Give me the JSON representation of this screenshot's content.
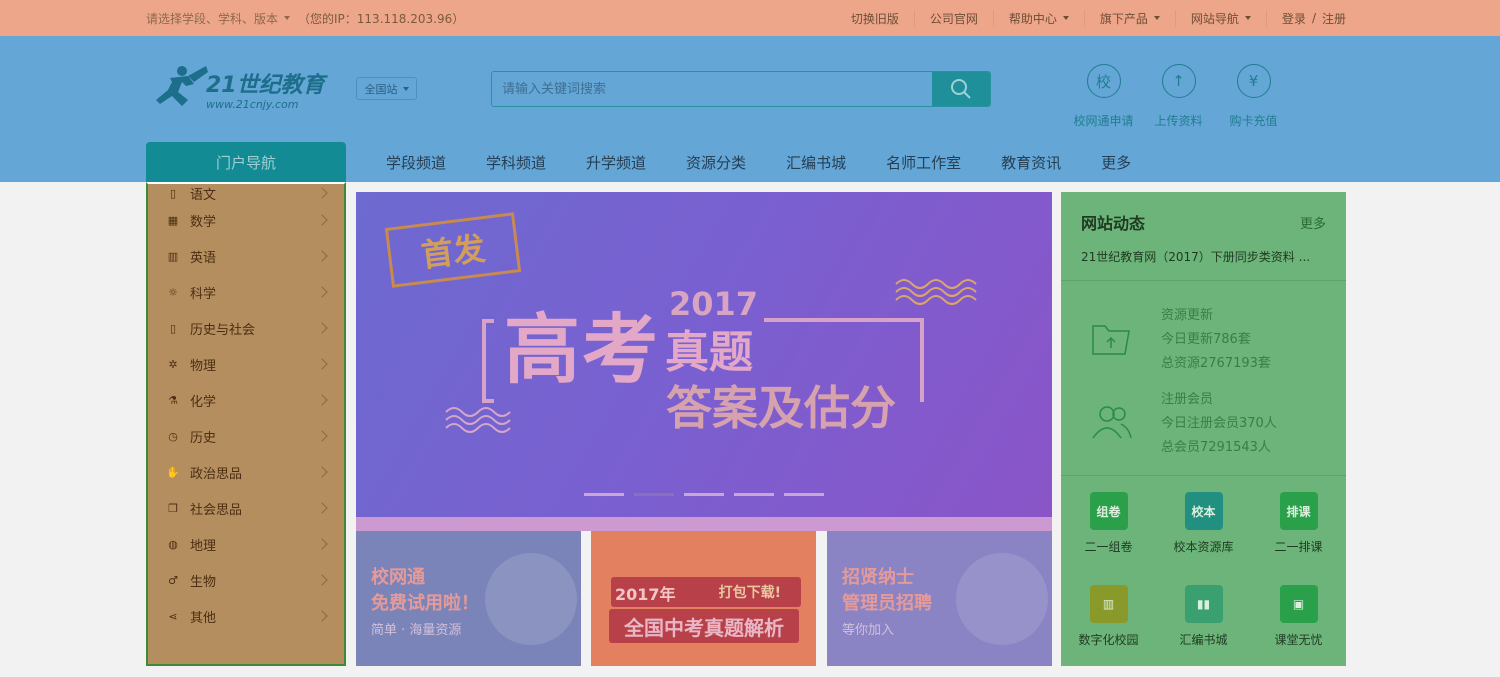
{
  "topbar": {
    "selector_label": "请选择学段、学科、版本",
    "ip_text": "（您的IP：113.118.203.96）",
    "links": [
      "切换旧版",
      "公司官网",
      "帮助中心",
      "旗下产品",
      "网站导航"
    ],
    "login": "登录",
    "divider": "/",
    "register": "注册"
  },
  "header": {
    "station_label": "全国站",
    "search_placeholder": "请输入关键词搜索",
    "icons": [
      {
        "glyph": "校",
        "label": "校网通申请"
      },
      {
        "glyph": "↑",
        "label": "上传资料"
      },
      {
        "glyph": "¥",
        "label": "购卡充值"
      }
    ]
  },
  "nav": {
    "portal_tab": "门户导航",
    "items": [
      "学段频道",
      "学科频道",
      "升学频道",
      "资源分类",
      "汇编书城",
      "名师工作室",
      "教育资讯",
      "更多"
    ]
  },
  "sidebar": {
    "items": [
      {
        "label": "语文",
        "icon": "book-icon"
      },
      {
        "label": "数学",
        "icon": "calculator-icon"
      },
      {
        "label": "英语",
        "icon": "abc-icon"
      },
      {
        "label": "科学",
        "icon": "bulb-icon"
      },
      {
        "label": "历史与社会",
        "icon": "columns-icon"
      },
      {
        "label": "物理",
        "icon": "gear-icon"
      },
      {
        "label": "化学",
        "icon": "flask-icon"
      },
      {
        "label": "历史",
        "icon": "clock-icon"
      },
      {
        "label": "政治思品",
        "icon": "hand-icon"
      },
      {
        "label": "社会思品",
        "icon": "copy-icon"
      },
      {
        "label": "地理",
        "icon": "globe-icon"
      },
      {
        "label": "生物",
        "icon": "microscope-icon"
      },
      {
        "label": "其他",
        "icon": "share-icon"
      }
    ]
  },
  "banner": {
    "stamp": "首发",
    "year": "2017",
    "title_big": "高考",
    "title_zt": "真题",
    "subtitle": "答案及估分",
    "dots": 5,
    "active_dot": 1
  },
  "promos": [
    {
      "line1": "校网通",
      "line2": "免费试用啦！",
      "line3": "简单 · 海量资源"
    },
    {
      "year_label": "2017年",
      "badge": "打包下载!",
      "title": "全国中考真题解析"
    },
    {
      "line1": "招贤纳士",
      "line2": "管理员招聘",
      "line3": "等你加入"
    }
  ],
  "right_panel": {
    "title": "网站动态",
    "more": "更多",
    "news": "21世纪教育网（2017）下册同步类资料 ...",
    "resources": {
      "title": "资源更新",
      "today": "今日更新786套",
      "total": "总资源2767193套"
    },
    "members": {
      "title": "注册会员",
      "today": "今日注册会员370人",
      "total": "总会员7291543人"
    },
    "apps": [
      {
        "label": "二一组卷",
        "glyph": "组卷",
        "color": "#2aa04a"
      },
      {
        "label": "校本资源库",
        "glyph": "校本",
        "color": "#229080"
      },
      {
        "label": "二一排课",
        "glyph": "排课",
        "color": "#2aa04a"
      },
      {
        "label": "数字化校园",
        "glyph": "▥",
        "color": "#8a9a2a"
      },
      {
        "label": "汇编书城",
        "glyph": "▮▮",
        "color": "#3aa070"
      },
      {
        "label": "课堂无忧",
        "glyph": "▣",
        "color": "#2aa04a"
      }
    ]
  },
  "logo": {
    "text": "21世纪教育",
    "sub": "www.21cnjy.com"
  }
}
